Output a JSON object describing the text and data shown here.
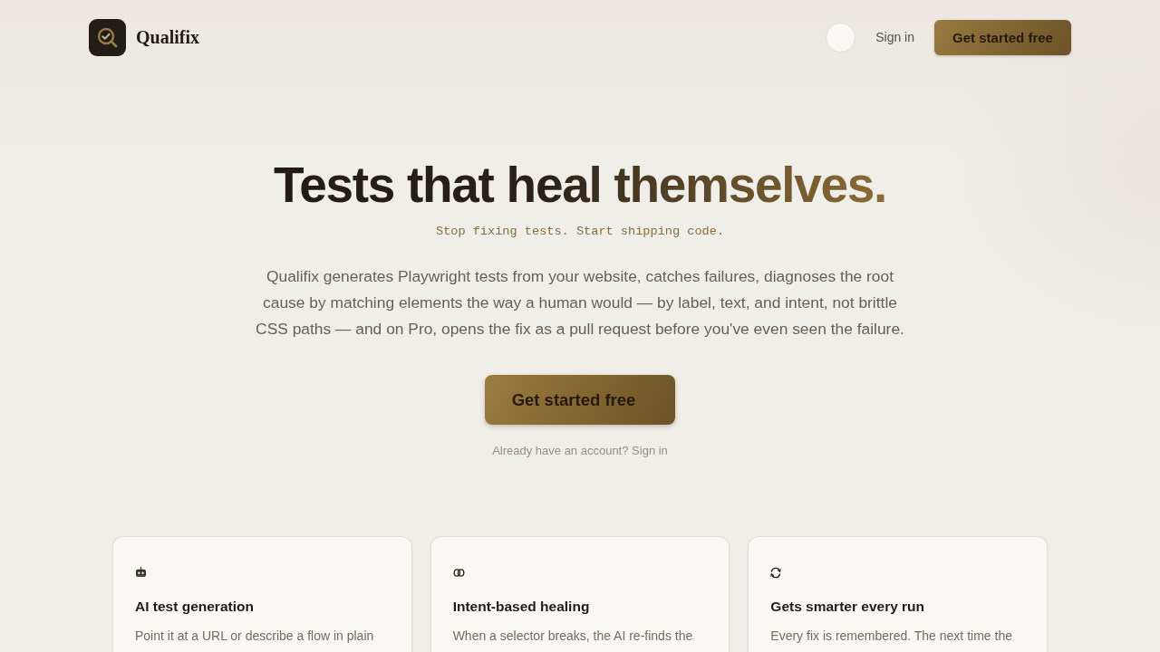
{
  "nav": {
    "brand": "Qualifix",
    "link": "Sign in",
    "cta": "Get started free"
  },
  "hero": {
    "title": "Tests that heal themselves.",
    "tagline": "Stop fixing tests. Start shipping code.",
    "description": "Qualifix generates Playwright tests from your website, catches failures, diagnoses the root cause by matching elements the way a human would — by label, text, and intent, not brittle CSS paths — and on Pro, opens the fix as a pull request before you've even seen the failure.",
    "cta": "Get started free",
    "signin_prompt": {
      "text": "Already have an account?",
      "link": "Sign in"
    }
  },
  "features": [
    {
      "title": "AI test generation",
      "description": "Point it at a URL or describe a flow in plain"
    },
    {
      "title": "Intent-based healing",
      "description": "When a selector breaks, the AI re-finds the"
    },
    {
      "title": "Gets smarter every run",
      "description": "Every fix is remembered. The next time the"
    }
  ]
}
